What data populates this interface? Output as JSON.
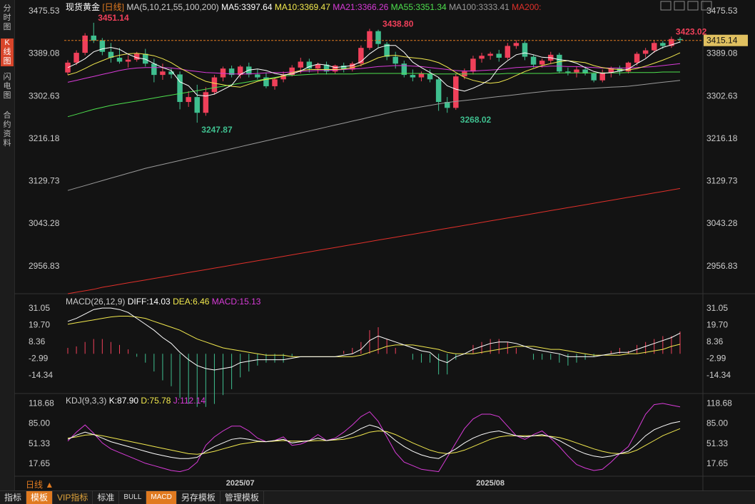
{
  "sidebar": {
    "tabs": [
      "分时图",
      "K线图",
      "闪电图",
      "合约资料"
    ],
    "active_index": 1
  },
  "chart_title": "现货黄金",
  "period_tag": "[日线]",
  "period_label": "日线 ▲",
  "bottom_tabs": [
    "指标",
    "模板",
    "VIP指标",
    "标准",
    "BULL",
    "MACD",
    "另存模板",
    "管理模板"
  ],
  "colors": {
    "up": "#f0405a",
    "down": "#3fbf8f",
    "ma5": "#ffffff",
    "ma10": "#f2e94e",
    "ma21": "#d83bd8",
    "ma55": "#4ee04e",
    "ma100": "#9a9a9a",
    "ma200": "#e0302a",
    "diff": "#ffffff",
    "dea": "#f2e94e",
    "kdj_k": "#ffffff",
    "kdj_d": "#f2e94e",
    "kdj_j": "#d83bd8"
  },
  "chart_data": [
    {
      "type": "candlestick",
      "title": "现货黄金 [日线]",
      "legend": [
        "MA(5,10,21,55,100,200)",
        "MA5:3397.64",
        "MA10:3369.47",
        "MA21:3366.26",
        "MA55:3351.34",
        "MA100:3333.41",
        "MA200:"
      ],
      "yticks": [
        "3475.53",
        "3389.08",
        "3302.63",
        "3216.18",
        "3129.73",
        "3043.28",
        "2956.83"
      ],
      "ylim": [
        2900,
        3480
      ],
      "xlabels": [
        {
          "label": "2025/07",
          "index": 20
        },
        {
          "label": "2025/08",
          "index": 49
        }
      ],
      "last_price": "3415.14",
      "annotations": [
        {
          "text": "3451.14",
          "index": 3
        },
        {
          "text": "3247.87",
          "index": 15
        },
        {
          "text": "3438.80",
          "index": 36
        },
        {
          "text": "3268.02",
          "index": 45
        },
        {
          "text": "3423.02",
          "index": 70
        }
      ],
      "candles": [
        [
          3350,
          3375,
          3345,
          3370
        ],
        [
          3370,
          3395,
          3365,
          3390
        ],
        [
          3390,
          3430,
          3385,
          3425
        ],
        [
          3425,
          3451.14,
          3410,
          3415
        ],
        [
          3415,
          3420,
          3385,
          3392
        ],
        [
          3392,
          3410,
          3370,
          3380
        ],
        [
          3380,
          3400,
          3368,
          3372
        ],
        [
          3372,
          3385,
          3360,
          3376
        ],
        [
          3376,
          3392,
          3372,
          3388
        ],
        [
          3388,
          3398,
          3362,
          3368
        ],
        [
          3368,
          3378,
          3330,
          3345
        ],
        [
          3345,
          3368,
          3335,
          3352
        ],
        [
          3352,
          3358,
          3338,
          3346
        ],
        [
          3346,
          3352,
          3275,
          3290
        ],
        [
          3290,
          3312,
          3280,
          3300
        ],
        [
          3300,
          3325,
          3247.87,
          3268
        ],
        [
          3268,
          3320,
          3262,
          3310
        ],
        [
          3310,
          3345,
          3305,
          3340
        ],
        [
          3340,
          3362,
          3332,
          3358
        ],
        [
          3358,
          3364,
          3340,
          3345
        ],
        [
          3345,
          3365,
          3338,
          3362
        ],
        [
          3362,
          3370,
          3340,
          3346
        ],
        [
          3346,
          3356,
          3336,
          3340
        ],
        [
          3340,
          3350,
          3318,
          3322
        ],
        [
          3322,
          3340,
          3315,
          3336
        ],
        [
          3336,
          3352,
          3330,
          3345
        ],
        [
          3345,
          3365,
          3342,
          3360
        ],
        [
          3360,
          3380,
          3348,
          3372
        ],
        [
          3372,
          3378,
          3350,
          3358
        ],
        [
          3358,
          3370,
          3348,
          3366
        ],
        [
          3366,
          3372,
          3346,
          3352
        ],
        [
          3352,
          3366,
          3348,
          3364
        ],
        [
          3364,
          3370,
          3350,
          3356
        ],
        [
          3356,
          3372,
          3352,
          3368
        ],
        [
          3368,
          3405,
          3362,
          3400
        ],
        [
          3400,
          3438.8,
          3396,
          3434
        ],
        [
          3434,
          3437,
          3400,
          3408
        ],
        [
          3408,
          3412,
          3375,
          3382
        ],
        [
          3382,
          3392,
          3358,
          3368
        ],
        [
          3368,
          3374,
          3340,
          3345
        ],
        [
          3345,
          3356,
          3332,
          3340
        ],
        [
          3340,
          3352,
          3332,
          3348
        ],
        [
          3348,
          3356,
          3330,
          3336
        ],
        [
          3336,
          3340,
          3272,
          3290
        ],
        [
          3290,
          3300,
          3268.02,
          3278
        ],
        [
          3278,
          3348,
          3274,
          3342
        ],
        [
          3342,
          3358,
          3336,
          3352
        ],
        [
          3352,
          3384,
          3346,
          3378
        ],
        [
          3378,
          3390,
          3370,
          3384
        ],
        [
          3384,
          3392,
          3376,
          3388
        ],
        [
          3388,
          3396,
          3372,
          3380
        ],
        [
          3380,
          3410,
          3376,
          3404
        ],
        [
          3404,
          3416,
          3398,
          3410
        ],
        [
          3410,
          3414,
          3375,
          3382
        ],
        [
          3382,
          3386,
          3360,
          3366
        ],
        [
          3366,
          3378,
          3360,
          3374
        ],
        [
          3374,
          3392,
          3368,
          3386
        ],
        [
          3386,
          3390,
          3348,
          3352
        ],
        [
          3352,
          3360,
          3344,
          3350
        ],
        [
          3350,
          3362,
          3340,
          3356
        ],
        [
          3356,
          3362,
          3344,
          3348
        ],
        [
          3348,
          3350,
          3330,
          3334
        ],
        [
          3334,
          3356,
          3330,
          3350
        ],
        [
          3350,
          3362,
          3340,
          3358
        ],
        [
          3358,
          3364,
          3344,
          3352
        ],
        [
          3352,
          3372,
          3348,
          3370
        ],
        [
          3370,
          3392,
          3364,
          3388
        ],
        [
          3388,
          3400,
          3380,
          3395
        ],
        [
          3395,
          3416,
          3390,
          3410
        ],
        [
          3410,
          3414,
          3398,
          3404
        ],
        [
          3404,
          3423.02,
          3400,
          3418
        ],
        [
          3418,
          3422,
          3410,
          3416
        ]
      ],
      "ma5": [
        3360,
        3368,
        3378,
        3392,
        3398,
        3401,
        3397,
        3387,
        3380,
        3377,
        3368,
        3360,
        3354,
        3331,
        3323,
        3304,
        3302,
        3306,
        3315,
        3324,
        3346,
        3355,
        3357,
        3354,
        3348,
        3345,
        3347,
        3353,
        3362,
        3367,
        3365,
        3360,
        3362,
        3364,
        3372,
        3388,
        3400,
        3405,
        3405,
        3391,
        3371,
        3360,
        3350,
        3340,
        3323,
        3316,
        3312,
        3318,
        3326,
        3336,
        3360,
        3374,
        3386,
        3390,
        3386,
        3381,
        3380,
        3376,
        3374,
        3369,
        3360,
        3352,
        3348,
        3350,
        3353,
        3357,
        3368,
        3378,
        3392,
        3401,
        3406,
        3412
      ],
      "ma10": [
        3345,
        3350,
        3358,
        3367,
        3374,
        3381,
        3385,
        3388,
        3389,
        3387,
        3384,
        3378,
        3370,
        3359,
        3350,
        3340,
        3332,
        3328,
        3325,
        3322,
        3320,
        3326,
        3332,
        3336,
        3338,
        3343,
        3350,
        3354,
        3356,
        3356,
        3356,
        3356,
        3357,
        3360,
        3365,
        3372,
        3380,
        3384,
        3385,
        3382,
        3380,
        3378,
        3375,
        3370,
        3361,
        3350,
        3340,
        3334,
        3330,
        3328,
        3330,
        3336,
        3344,
        3352,
        3358,
        3364,
        3368,
        3372,
        3374,
        3372,
        3370,
        3364,
        3360,
        3357,
        3356,
        3355,
        3358,
        3363,
        3369,
        3375,
        3382,
        3390
      ],
      "ma21": [
        3330,
        3334,
        3338,
        3342,
        3346,
        3350,
        3354,
        3357,
        3359,
        3360,
        3360,
        3360,
        3359,
        3357,
        3354,
        3352,
        3350,
        3349,
        3348,
        3347,
        3347,
        3347,
        3348,
        3349,
        3350,
        3350,
        3351,
        3352,
        3353,
        3354,
        3354,
        3355,
        3356,
        3357,
        3358,
        3360,
        3362,
        3363,
        3364,
        3364,
        3363,
        3362,
        3360,
        3358,
        3356,
        3354,
        3353,
        3353,
        3354,
        3355,
        3356,
        3358,
        3360,
        3361,
        3362,
        3362,
        3363,
        3363,
        3362,
        3362,
        3361,
        3360,
        3359,
        3359,
        3359,
        3359,
        3360,
        3361,
        3362,
        3364,
        3366,
        3368
      ],
      "ma55": [
        3260,
        3265,
        3270,
        3275,
        3279,
        3283,
        3286,
        3289,
        3292,
        3295,
        3298,
        3301,
        3304,
        3307,
        3310,
        3313,
        3316,
        3319,
        3322,
        3325,
        3328,
        3331,
        3334,
        3337,
        3340,
        3343,
        3344,
        3345,
        3346,
        3347,
        3347,
        3347,
        3347,
        3347,
        3348,
        3348,
        3348,
        3348,
        3348,
        3348,
        3348,
        3348,
        3347,
        3347,
        3347,
        3347,
        3347,
        3347,
        3347,
        3347,
        3347,
        3348,
        3348,
        3348,
        3348,
        3348,
        3348,
        3349,
        3349,
        3349,
        3349,
        3349,
        3349,
        3349,
        3349,
        3350,
        3350,
        3350,
        3350,
        3351,
        3351,
        3351
      ],
      "ma100": [
        3110,
        3115,
        3120,
        3125,
        3130,
        3135,
        3140,
        3145,
        3150,
        3155,
        3159,
        3163,
        3167,
        3171,
        3175,
        3179,
        3183,
        3187,
        3191,
        3195,
        3199,
        3203,
        3207,
        3211,
        3215,
        3219,
        3223,
        3227,
        3231,
        3235,
        3239,
        3243,
        3247,
        3251,
        3255,
        3259,
        3263,
        3267,
        3271,
        3274,
        3277,
        3280,
        3283,
        3286,
        3289,
        3291,
        3293,
        3295,
        3297,
        3299,
        3301,
        3303,
        3305,
        3307,
        3309,
        3311,
        3313,
        3314,
        3315,
        3316,
        3317,
        3318,
        3319,
        3320,
        3321,
        3322,
        3324,
        3326,
        3328,
        3330,
        3332,
        3334
      ],
      "ma200": [
        2900,
        2903,
        2906,
        2909,
        2913,
        2916,
        2919,
        2922,
        2925,
        2928,
        2931,
        2934,
        2937,
        2940,
        2943,
        2946,
        2949,
        2952,
        2955,
        2958,
        2961,
        2964,
        2967,
        2970,
        2973,
        2976,
        2979,
        2982,
        2985,
        2988,
        2991,
        2994,
        2997,
        3000,
        3003,
        3006,
        3009,
        3012,
        3015,
        3018,
        3021,
        3024,
        3027,
        3030,
        3033,
        3036,
        3039,
        3042,
        3045,
        3048,
        3051,
        3054,
        3057,
        3060,
        3063,
        3066,
        3069,
        3072,
        3075,
        3078,
        3081,
        3084,
        3087,
        3090,
        3093,
        3096,
        3099,
        3102,
        3105,
        3108,
        3111,
        3114
      ]
    },
    {
      "type": "macd",
      "legend": [
        "MACD(26,12,9)",
        "DIFF:14.03",
        "DEA:6.46",
        "MACD:15.13"
      ],
      "yticks": [
        "31.05",
        "19.70",
        "8.36",
        "-2.99",
        "-14.34"
      ],
      "ylim": [
        -25,
        33
      ],
      "diff": [
        22,
        24,
        27,
        30,
        31,
        31,
        30,
        28,
        24,
        20,
        16,
        11,
        7,
        1,
        -4,
        -8,
        -10,
        -11,
        -10,
        -9,
        -6,
        -5,
        -4,
        -4,
        -4,
        -4,
        -3,
        -2,
        -2,
        -2,
        -2,
        -2,
        -1,
        0,
        3,
        9,
        12,
        10,
        8,
        6,
        4,
        2,
        1,
        -4,
        -6,
        -2,
        0,
        3,
        5,
        7,
        8,
        8,
        7,
        5,
        3,
        2,
        1,
        0,
        -2,
        -2,
        -2,
        -2,
        -1,
        0,
        1,
        1,
        3,
        5,
        7,
        9,
        11,
        14
      ],
      "dea": [
        20,
        21,
        22,
        23,
        24,
        25,
        25.5,
        25.5,
        25,
        24,
        22,
        20,
        18,
        16,
        13,
        10,
        8,
        6,
        4,
        3,
        2,
        1,
        0,
        -1,
        -1,
        -1,
        -2,
        -2,
        -2,
        -2,
        -2,
        -2,
        -2,
        -2,
        -1,
        1,
        3,
        5,
        6,
        6,
        6,
        5,
        4,
        3,
        1,
        0,
        0,
        0,
        1,
        2,
        3,
        4,
        5,
        5,
        5,
        4,
        3,
        3,
        2,
        1,
        0,
        -1,
        -1,
        -1,
        -1,
        0,
        0,
        1,
        2,
        3,
        5,
        6.46
      ],
      "hist": [
        4,
        5,
        8,
        10,
        10,
        8,
        6,
        3,
        -2,
        -6,
        -12,
        -18,
        -22,
        -30,
        -34,
        -36,
        -36,
        -34,
        -28,
        -24,
        -16,
        -12,
        -8,
        -6,
        -6,
        -6,
        -2,
        0,
        0,
        0,
        0,
        0,
        2,
        4,
        8,
        16,
        18,
        10,
        4,
        0,
        -4,
        -6,
        -6,
        -14,
        -14,
        -4,
        0,
        6,
        8,
        10,
        10,
        8,
        4,
        0,
        -4,
        -4,
        -4,
        -6,
        -8,
        -6,
        -4,
        -2,
        0,
        2,
        4,
        2,
        6,
        8,
        10,
        12,
        12,
        15.13
      ]
    },
    {
      "type": "kdj",
      "legend": [
        "KDJ(9,3,3)",
        "K:87.90",
        "D:75.78",
        "J:112.14"
      ],
      "yticks": [
        "118.68",
        "85.00",
        "51.33",
        "17.65"
      ],
      "ylim": [
        0,
        125
      ],
      "k": [
        58,
        65,
        70,
        66,
        60,
        54,
        50,
        46,
        42,
        38,
        34,
        31,
        28,
        26,
        26,
        28,
        38,
        46,
        52,
        58,
        60,
        58,
        55,
        54,
        56,
        58,
        52,
        54,
        56,
        60,
        56,
        58,
        62,
        68,
        76,
        82,
        78,
        68,
        56,
        46,
        38,
        32,
        28,
        26,
        34,
        42,
        52,
        60,
        66,
        70,
        72,
        68,
        64,
        62,
        64,
        66,
        62,
        56,
        48,
        40,
        34,
        30,
        28,
        30,
        34,
        38,
        50,
        64,
        74,
        80,
        85,
        87.9
      ],
      "d": [
        60,
        62,
        65,
        66,
        64,
        61,
        58,
        55,
        52,
        49,
        46,
        43,
        40,
        37,
        34,
        33,
        35,
        38,
        42,
        46,
        50,
        52,
        54,
        54,
        55,
        56,
        55,
        55,
        55,
        56,
        56,
        57,
        58,
        61,
        65,
        70,
        72,
        71,
        66,
        59,
        52,
        46,
        40,
        36,
        34,
        36,
        40,
        46,
        52,
        58,
        62,
        64,
        64,
        64,
        64,
        64,
        63,
        61,
        57,
        52,
        47,
        42,
        38,
        35,
        34,
        35,
        40,
        48,
        56,
        64,
        70,
        75.78
      ],
      "j": [
        55,
        70,
        82,
        68,
        52,
        42,
        36,
        30,
        24,
        18,
        14,
        10,
        6,
        4,
        8,
        20,
        48,
        62,
        72,
        80,
        80,
        72,
        60,
        54,
        56,
        62,
        48,
        50,
        56,
        66,
        56,
        60,
        70,
        82,
        96,
        104,
        88,
        62,
        36,
        20,
        14,
        8,
        6,
        4,
        28,
        52,
        76,
        92,
        100,
        100,
        96,
        80,
        64,
        58,
        66,
        72,
        60,
        46,
        30,
        16,
        10,
        6,
        8,
        20,
        34,
        46,
        72,
        100,
        116,
        118,
        115,
        112.14
      ]
    }
  ]
}
